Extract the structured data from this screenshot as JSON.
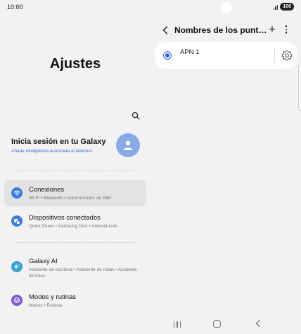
{
  "status_bar": {
    "time": "10:00",
    "battery": "100"
  },
  "left_pane": {
    "title": "Ajustes",
    "account": {
      "title": "Inicia sesión en tu Galaxy",
      "subtitle": "Añade inteligencia avanzada al teléfono."
    },
    "items": [
      {
        "title": "Conexiones",
        "subtitle": "Wi-Fi  •  Bluetooth  •  Administrador de SIM",
        "icon": "wifi-icon",
        "color": "#3d7be6"
      },
      {
        "title": "Dispositivos conectados",
        "subtitle": "Quick Share  •  Samsung DeX  •  Android Auto",
        "icon": "devices-icon",
        "color": "#3d7be6"
      },
      {
        "title": "Galaxy AI",
        "subtitle": "Asistente de escritura  •  Asistente de notas  •  Asistente de fotos",
        "icon": "sparkle-icon",
        "color": "#3aa0d8"
      },
      {
        "title": "Modos y rutinas",
        "subtitle": "Modos  •  Rutinas",
        "icon": "check-circle-icon",
        "color": "#7b59d6"
      }
    ]
  },
  "right_pane": {
    "title": "Nombres de los punt…",
    "add_label": "+",
    "apns": [
      {
        "label": "APN 1",
        "selected": true
      }
    ]
  },
  "colors": {
    "accent": "#2a63d4",
    "background": "#f2f2f2",
    "card": "#ffffff",
    "selected_item": "#e3e3e3"
  }
}
